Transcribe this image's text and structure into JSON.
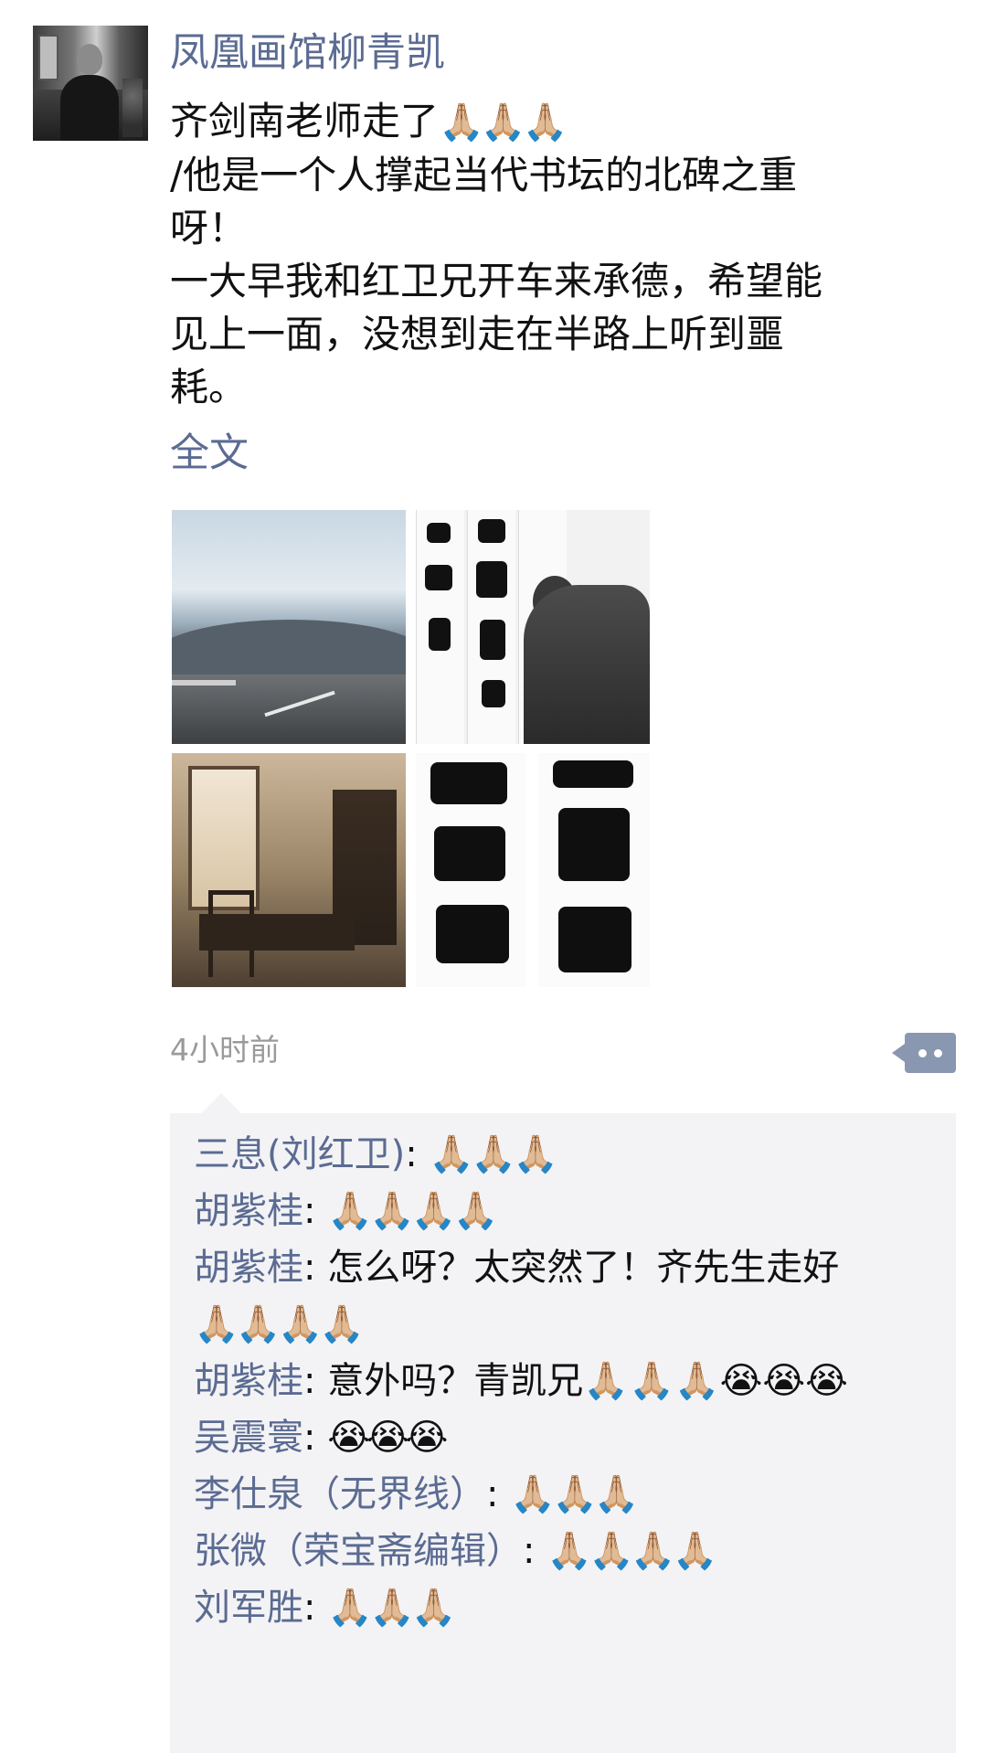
{
  "post": {
    "author": "凤凰画馆柳青凯",
    "text_lines": [
      "齐剑南老师走了",
      "/他是一个人撑起当代书坛的北碑之重",
      "呀！",
      "一大早我和红卫兄开车来承德，希望能",
      "见上一面，没想到走在半路上听到噩",
      "耗。"
    ],
    "text_emoji": "🙏🏼🙏🏼🙏🏼",
    "fulltext_label": "全文",
    "timestamp": "4小时前",
    "more_icon": "more-dots-icon"
  },
  "photos": [
    {
      "name": "photo-highway",
      "icon": "road-landscape"
    },
    {
      "name": "photo-calligrapher",
      "icon": "artist-writing"
    },
    {
      "name": "photo-study-room",
      "icon": "interior-room"
    },
    {
      "name": "photo-calligraphy-scrolls",
      "icon": "calligraphy"
    }
  ],
  "comments": [
    {
      "user": "三息(刘红卫)",
      "sep": ": ",
      "text": "🙏🏼🙏🏼🙏🏼"
    },
    {
      "user": "胡紫桂",
      "sep": ": ",
      "text": "🙏🏼🙏🏼🙏🏼🙏🏼"
    },
    {
      "user": "胡紫桂",
      "sep": ": ",
      "text": "怎么呀？太突然了！齐先生走好",
      "text2": "🙏🏼🙏🏼🙏🏼🙏🏼"
    },
    {
      "user": "胡紫桂",
      "sep": ": ",
      "text": "意外吗？青凯兄🙏🏼🙏🏼🙏🏼😭😭😭"
    },
    {
      "user": "吴震寰",
      "sep": ": ",
      "text": "😭😭😭"
    },
    {
      "user": "李仕泉（无界线）",
      "sep": ": ",
      "text": "🙏🏼🙏🏼🙏🏼"
    },
    {
      "user": "张微（荣宝斋编辑）",
      "sep": ": ",
      "text": "🙏🏼🙏🏼🙏🏼🙏🏼"
    },
    {
      "user": "刘军胜",
      "sep": ": ",
      "text": "🙏🏼🙏🏼🙏🏼"
    }
  ],
  "colors": {
    "link": "#5b6b92",
    "timestamp": "#9a9a9a",
    "comment_bg": "#f3f3f5",
    "more_button": "#8a97b1"
  }
}
